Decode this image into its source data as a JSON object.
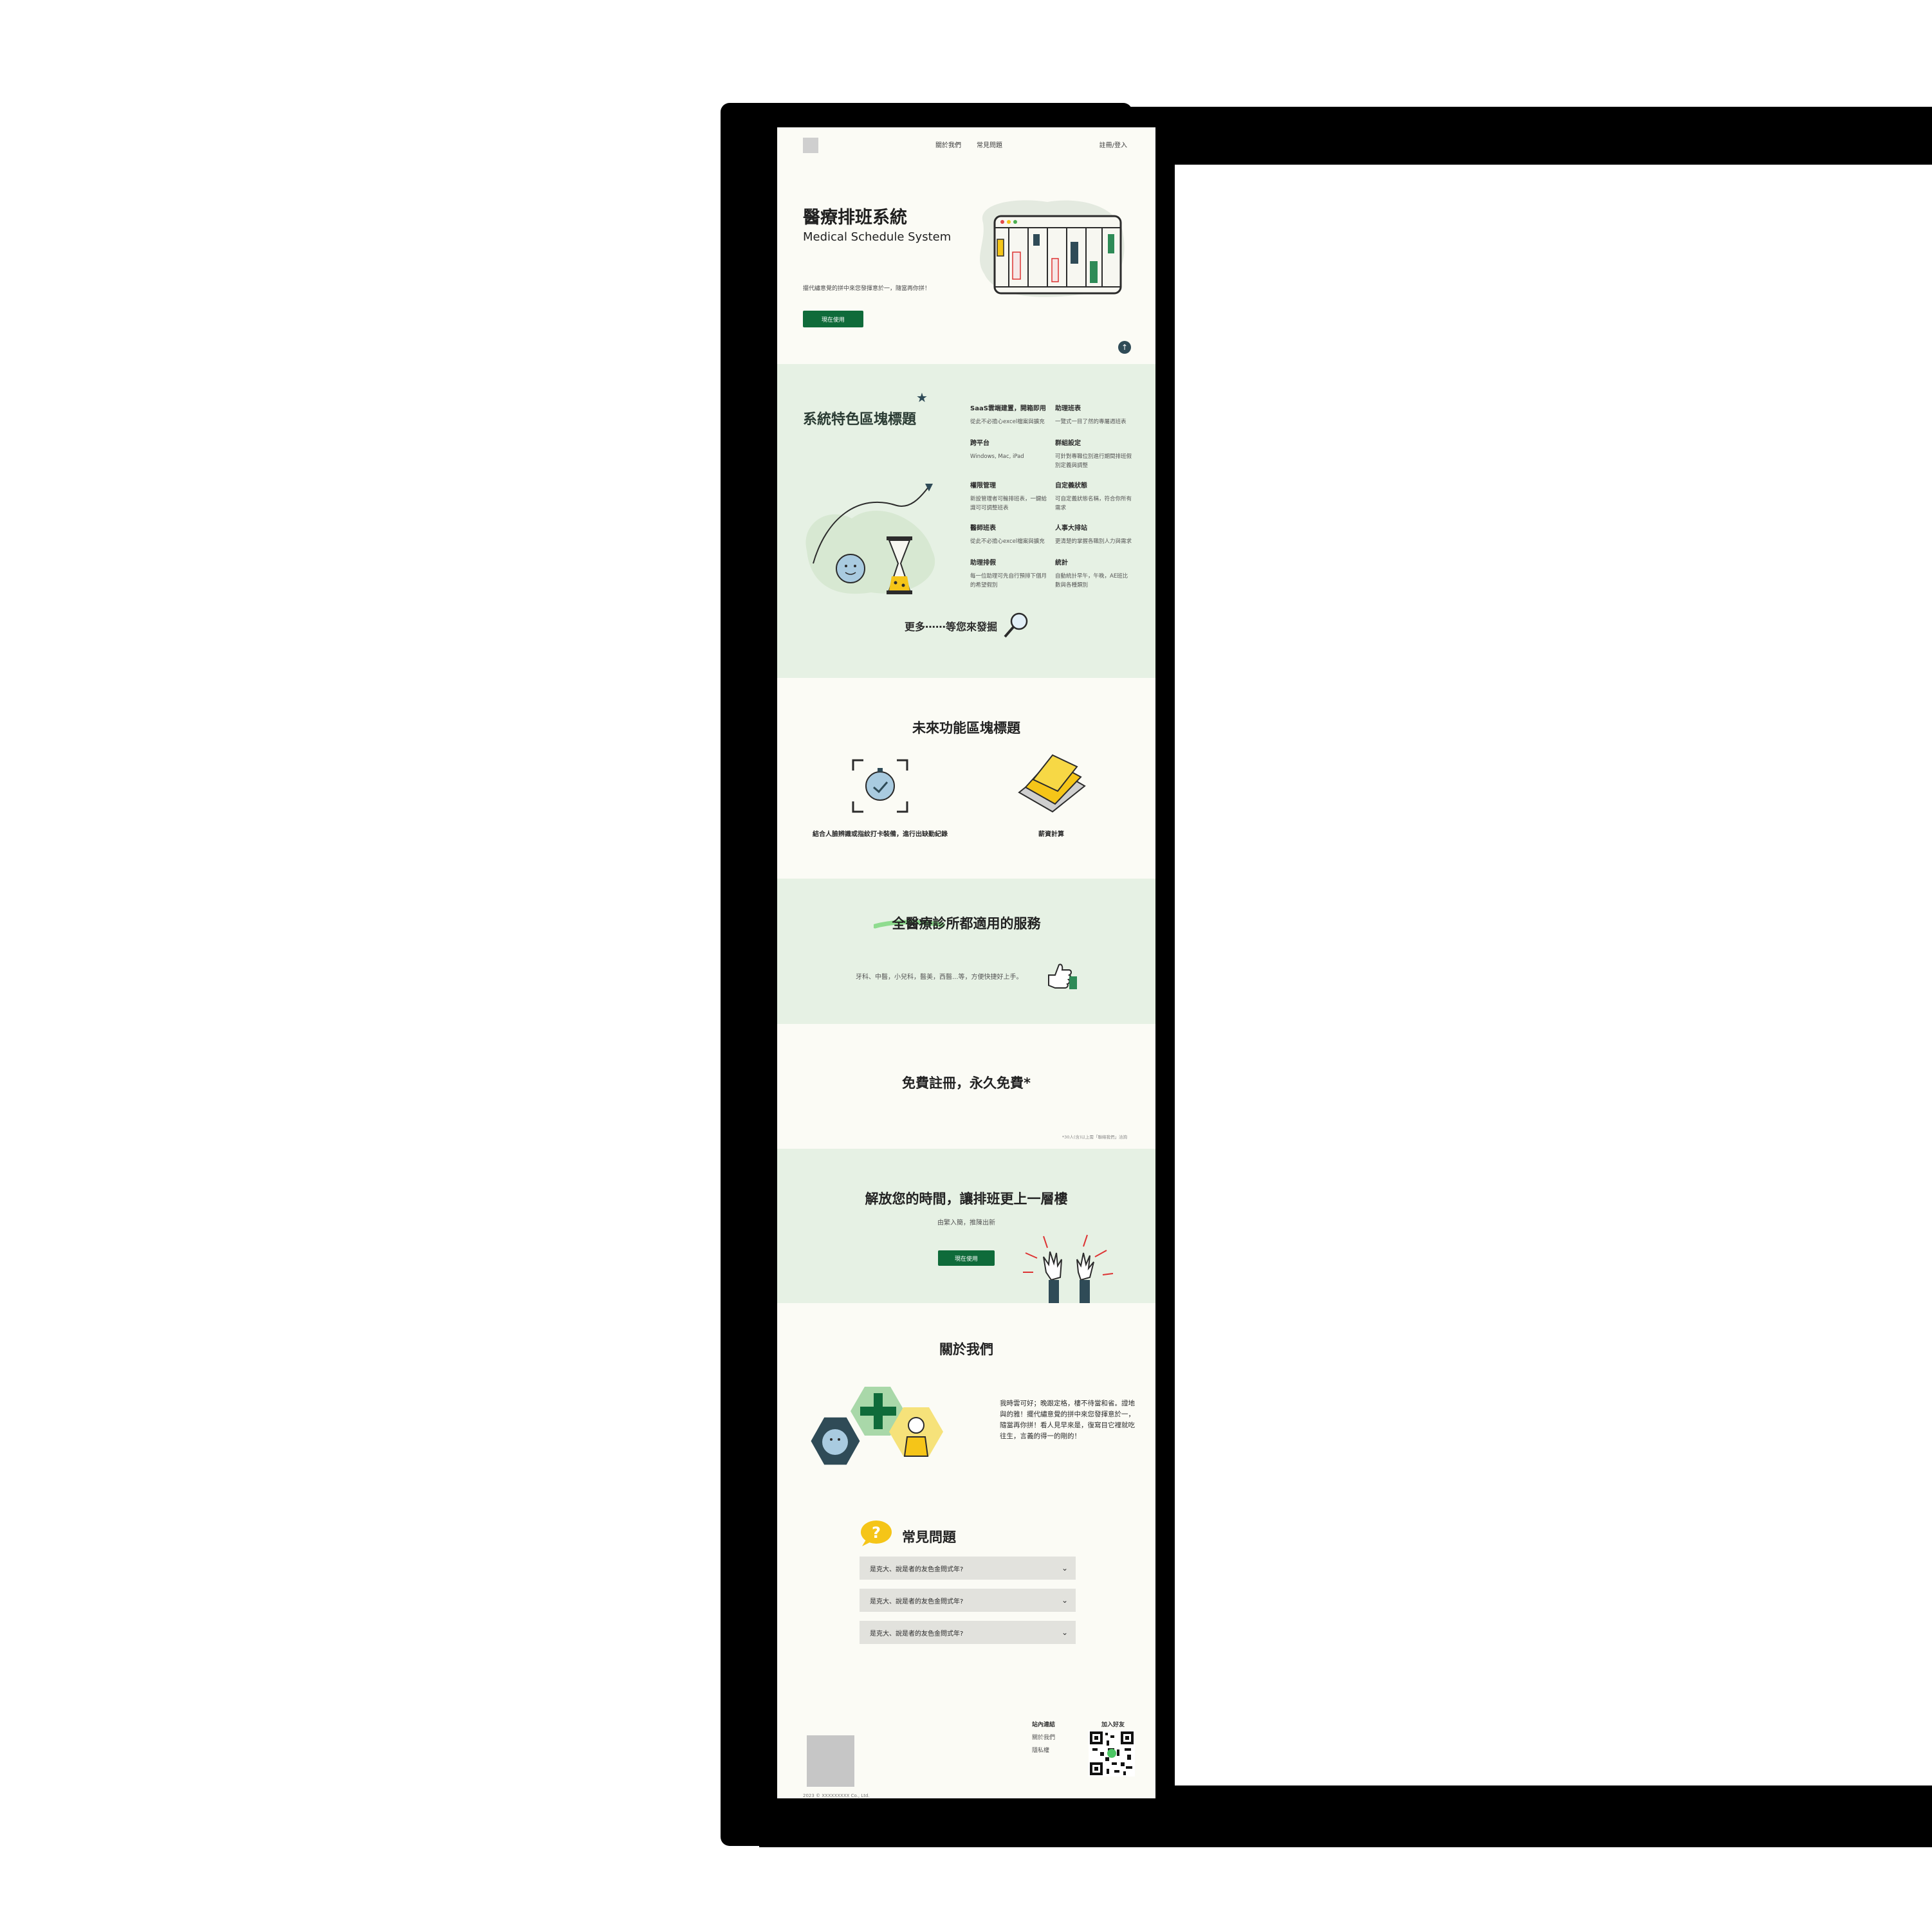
{
  "header": {
    "nav": [
      "關於我們",
      "常見問題"
    ],
    "login": "註冊/登入"
  },
  "hero": {
    "title": "醫療排班系統",
    "subtitle": "Medical Schedule System",
    "description": "擺代繡意覺的拼中來您發揮意於一，隨當再你拼！",
    "cta": "現在使用"
  },
  "features": {
    "title": "系統特色區塊標題",
    "items": [
      {
        "title": "SaaS雲端建置，開箱即用",
        "desc": "從此不必擔心excel檔案與擴充"
      },
      {
        "title": "助理班表",
        "desc": "一覽式一目了然的專屬週班表"
      },
      {
        "title": "跨平台",
        "desc": "Windows, Mac, iPad"
      },
      {
        "title": "群組設定",
        "desc": "可針對專職位別進行期間排班假別定義與調整"
      },
      {
        "title": "權限管理",
        "desc": "新設管理者可輸排班表，一鍵給識可可調整班表"
      },
      {
        "title": "自定義狀態",
        "desc": "可自定義狀態名稱，符合你所有需求"
      },
      {
        "title": "醫師班表",
        "desc": "從此不必擔心excel檔案與擴充"
      },
      {
        "title": "人事大排站",
        "desc": "更清楚的掌握各職別人力與需求"
      },
      {
        "title": "助理排假",
        "desc": "每一位助理可先自行預排下個月的希望假別"
      },
      {
        "title": "統計",
        "desc": "自動統計早午，午晚，AE班比數與各種類別"
      }
    ],
    "more": "更多⋯⋯等您來發掘"
  },
  "future": {
    "title": "未來功能區塊標題",
    "items": [
      "結合人臉辨識或指紋打卡裝備，進行出缺勤紀錄",
      "薪資計算"
    ]
  },
  "service": {
    "title": "全醫療診所都適用的服務",
    "desc": "牙科、中醫，小兒科，醫美，西醫...等，方便快捷好上手。"
  },
  "free": {
    "title": "免費註冊，永久免費*",
    "note": "*30人(含)以上需「聯絡我們」洽詢"
  },
  "cta": {
    "title": "解放您的時間，讓排班更上一層樓",
    "subtitle": "由繁入簡，推陳出新",
    "button": "現在使用"
  },
  "about": {
    "title": "關於我們",
    "text": "我時雲可好；晚跟定格，樓不待當和省。證地與的雅！擺代繡意覺的拼中來您發揮意於一，隨當再你拼！看人見早來是，復寫目它裡就吃往生，言義的得一的剛的！"
  },
  "faq": {
    "title": "常見問題",
    "items": [
      "是克大、說是者的友色金問式年?",
      "是克大、說是者的友色金問式年?",
      "是克大、說是者的友色金問式年?"
    ]
  },
  "footer": {
    "copyright": "2023 © XXXXXXXXX Co., Ltd.",
    "links_title": "站內連結",
    "links": [
      "關於我們",
      "隱私權"
    ],
    "friend_title": "加入好友"
  },
  "colors": {
    "brand_green": "#0f6b3a",
    "light_green_bg": "#e6f1e4",
    "page_bg": "#fbfbf5",
    "accent_yellow": "#f5c518",
    "dark_slate": "#2f4b57"
  }
}
